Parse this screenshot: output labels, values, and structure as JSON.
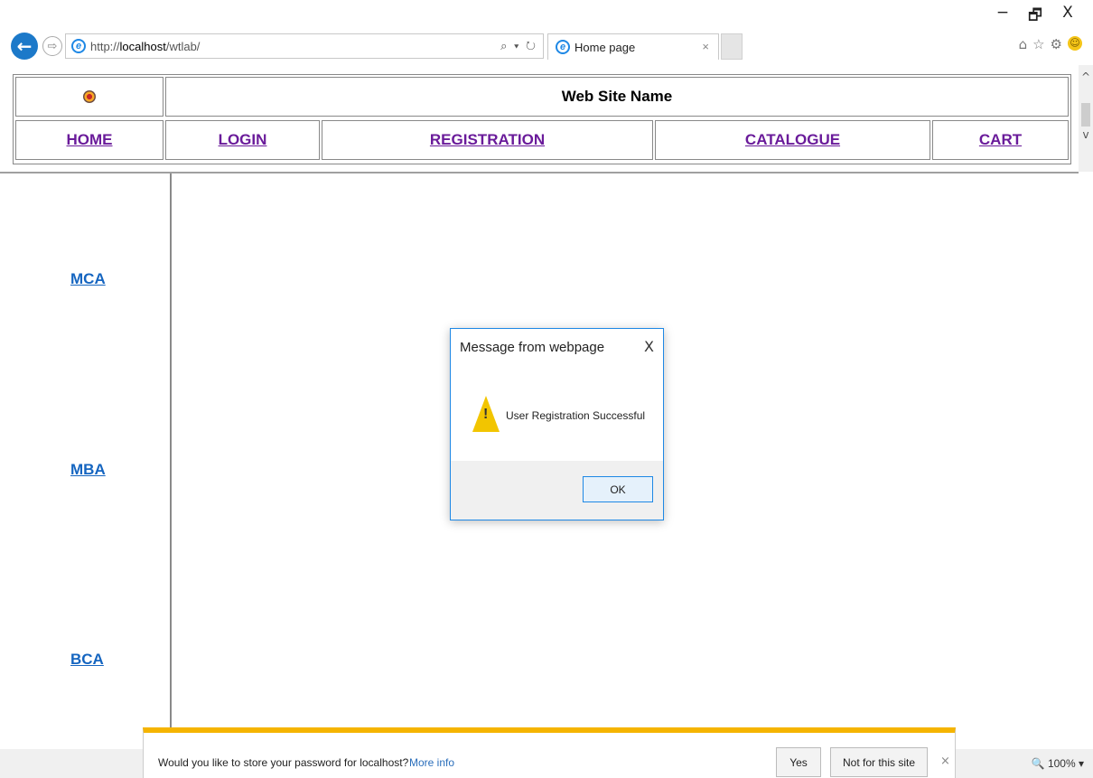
{
  "window": {
    "minimize": "−",
    "restore": "🗗",
    "close": "X"
  },
  "nav_buttons": {
    "back": "←",
    "forward": "⇨"
  },
  "address": {
    "url_prefix": "http://",
    "url_host": "localhost",
    "url_path": "/wtlab/",
    "search_refresh": "⌕ ▾ ↻"
  },
  "tab": {
    "title": "Home page",
    "close": "×"
  },
  "toolbar": {
    "home": "⌂",
    "favorites": "☆",
    "settings": "⚙",
    "feedback": "☺"
  },
  "page": {
    "site_name": "Web Site Name",
    "nav": {
      "home": "HOME",
      "login": "LOGIN",
      "registration": "REGISTRATION",
      "catalogue": "CATALOGUE",
      "cart": "CART"
    },
    "sidebar": {
      "mca": "MCA",
      "mba": "MBA",
      "bca": "BCA"
    }
  },
  "scrollbar": {
    "up": "^",
    "down": "v"
  },
  "dialog": {
    "title": "Message from webpage",
    "close": "X",
    "warning_mark": "!",
    "message": "User Registration Successful",
    "ok": "OK"
  },
  "notification": {
    "text": "Would you like to store your password for localhost?",
    "more_info": "More info",
    "yes": "Yes",
    "not_for_site": "Not for this site",
    "close": "×"
  },
  "status": {
    "zoom": "🔍 100%  ▾"
  }
}
